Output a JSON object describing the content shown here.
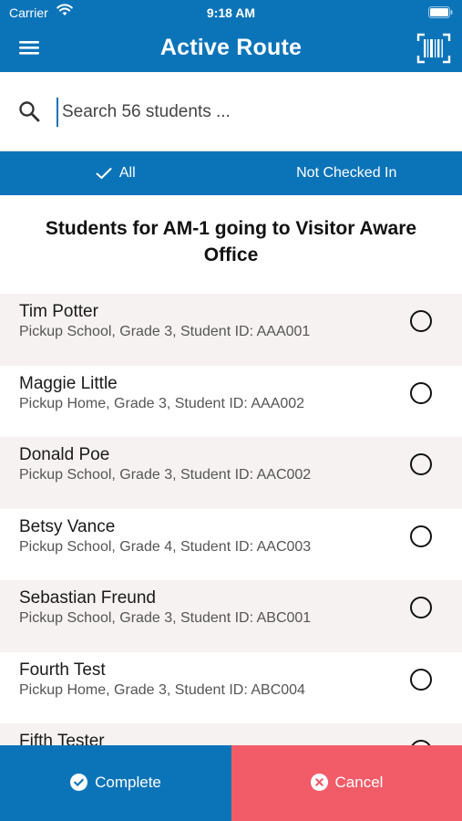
{
  "status_bar": {
    "carrier": "Carrier",
    "time": "9:18 AM",
    "wifi_icon": "wifi-icon",
    "battery_icon": "battery-icon"
  },
  "nav": {
    "title": "Active Route",
    "menu_icon": "hamburger-menu-icon",
    "scan_icon": "barcode-scan-icon"
  },
  "search": {
    "placeholder": "Search 56 students ...",
    "value": "",
    "icon": "search-icon"
  },
  "filters": {
    "all_label": "All",
    "not_checked_in_label": "Not Checked In",
    "selected": "All"
  },
  "list": {
    "heading": "Students for AM-1 going to Visitor Aware Office",
    "students": [
      {
        "name": "Tim Potter",
        "detail": "Pickup School, Grade 3, Student ID: AAA001"
      },
      {
        "name": "Maggie Little",
        "detail": "Pickup Home, Grade 3, Student ID: AAA002"
      },
      {
        "name": "Donald Poe",
        "detail": "Pickup School, Grade 3, Student ID: AAC002"
      },
      {
        "name": "Betsy Vance",
        "detail": "Pickup School, Grade 4, Student ID: AAC003"
      },
      {
        "name": "Sebastian Freund",
        "detail": "Pickup School, Grade 3, Student ID: ABC001"
      },
      {
        "name": "Fourth Test",
        "detail": "Pickup Home, Grade 3, Student ID: ABC004"
      },
      {
        "name": "Fifth Tester",
        "detail": ""
      }
    ]
  },
  "actions": {
    "complete_label": "Complete",
    "cancel_label": "Cancel",
    "complete_color": "#0b74b9",
    "cancel_color": "#f25c68"
  },
  "colors": {
    "primary": "#0b74b9",
    "row_shade": "#f6f2f1"
  }
}
